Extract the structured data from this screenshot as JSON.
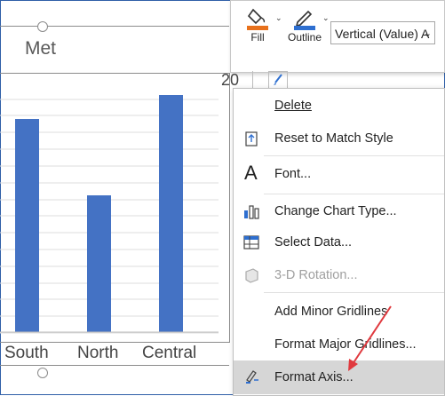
{
  "chart": {
    "title": "Met",
    "categories": [
      "South",
      "North",
      "Central"
    ],
    "bar_color": "#4472c4",
    "visible_y_tick": "20"
  },
  "ribbon": {
    "fill_label": "Fill",
    "outline_label": "Outline",
    "fill_icon": "paint-bucket-icon",
    "outline_icon": "pen-outline-icon",
    "element_select_value": "Vertical (Value) A",
    "fill_color": "#e8711c",
    "outline_color": "#2e6fd0"
  },
  "context_menu": {
    "items": [
      {
        "label": "Delete",
        "icon": "",
        "disabled": false
      },
      {
        "label": "Reset to Match Style",
        "icon": "reset-style-icon",
        "disabled": false
      },
      {
        "label": "Font...",
        "icon": "font-icon",
        "disabled": false
      },
      {
        "label": "Change Chart Type...",
        "icon": "chart-type-icon",
        "disabled": false
      },
      {
        "label": "Select Data...",
        "icon": "select-data-icon",
        "disabled": false
      },
      {
        "label": "3-D Rotation...",
        "icon": "rotation-3d-icon",
        "disabled": true
      },
      {
        "label": "Add Minor Gridlines",
        "icon": "",
        "disabled": false
      },
      {
        "label": "Format Major Gridlines...",
        "icon": "",
        "disabled": false
      },
      {
        "label": "Format Axis...",
        "icon": "format-axis-icon",
        "disabled": false,
        "highlighted": true
      }
    ]
  },
  "annotation": {
    "arrow_color": "#e0393e"
  }
}
